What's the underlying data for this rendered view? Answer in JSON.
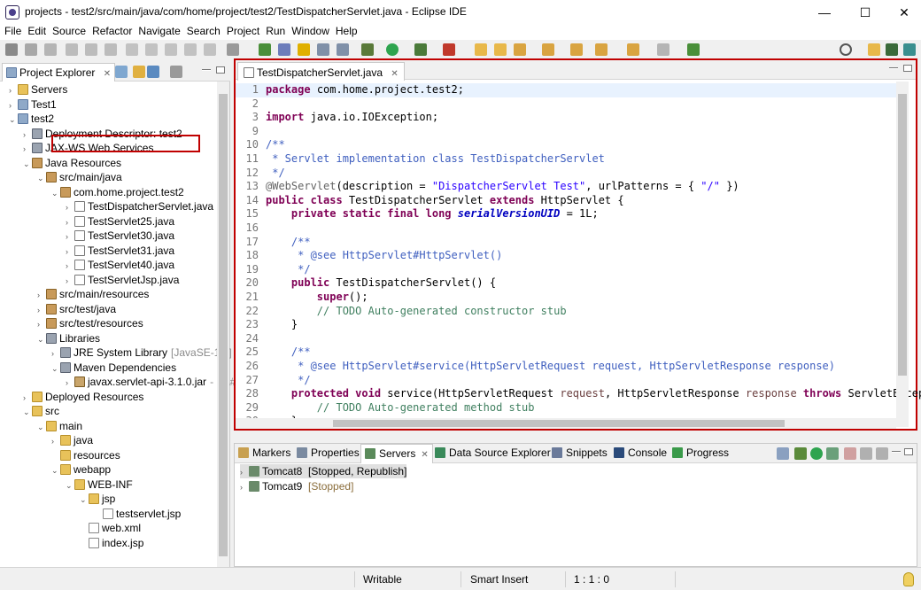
{
  "window": {
    "title": "projects - test2/src/main/java/com/home/project/test2/TestDispatcherServlet.java - Eclipse IDE",
    "min_glyph": "—",
    "max_glyph": "☐",
    "close_glyph": "✕"
  },
  "menu": [
    "File",
    "Edit",
    "Source",
    "Refactor",
    "Navigate",
    "Search",
    "Project",
    "Run",
    "Window",
    "Help"
  ],
  "project_explorer": {
    "tab_label": "Project Explorer",
    "close_glyph": "✕",
    "tree": [
      {
        "label": "Servers",
        "icon": "folder-icon",
        "arrow": "›"
      },
      {
        "label": "Test1",
        "icon": "project-icon",
        "arrow": "›"
      },
      {
        "label": "test2",
        "icon": "project-icon",
        "arrow": "⌄"
      },
      {
        "label": "Deployment Descriptor: test2",
        "icon": "descriptor-icon",
        "arrow": "›"
      },
      {
        "label": "JAX-WS Web Services",
        "icon": "webservice-icon",
        "arrow": "›"
      },
      {
        "label": "Java Resources",
        "icon": "java-resources-icon",
        "arrow": "⌄"
      },
      {
        "label": "src/main/java",
        "icon": "source-folder-icon",
        "arrow": "⌄"
      },
      {
        "label": "com.home.project.test2",
        "icon": "package-icon",
        "arrow": "⌄"
      },
      {
        "label": "TestDispatcherServlet.java",
        "icon": "java-file-icon",
        "arrow": "›"
      },
      {
        "label": "TestServlet25.java",
        "icon": "java-file-icon",
        "arrow": "›"
      },
      {
        "label": "TestServlet30.java",
        "icon": "java-file-icon",
        "arrow": "›"
      },
      {
        "label": "TestServlet31.java",
        "icon": "java-file-icon",
        "arrow": "›"
      },
      {
        "label": "TestServlet40.java",
        "icon": "java-file-icon",
        "arrow": "›"
      },
      {
        "label": "TestServletJsp.java",
        "icon": "java-file-icon",
        "arrow": "›"
      },
      {
        "label": "src/main/resources",
        "icon": "source-folder-icon",
        "arrow": "›"
      },
      {
        "label": "src/test/java",
        "icon": "source-folder-icon",
        "arrow": "›"
      },
      {
        "label": "src/test/resources",
        "icon": "source-folder-icon",
        "arrow": "›"
      },
      {
        "label": "Libraries",
        "icon": "library-icon",
        "arrow": "⌄"
      },
      {
        "label": "JRE System Library",
        "icon": "library-icon",
        "arrow": "›",
        "extra": "[JavaSE-1.8]"
      },
      {
        "label": "Maven Dependencies",
        "icon": "library-icon",
        "arrow": "⌄"
      },
      {
        "label": "javax.servlet-api-3.1.0.jar",
        "icon": "jar-icon",
        "arrow": "›",
        "extra": "- C:\\#"
      },
      {
        "label": "Deployed Resources",
        "icon": "folder-icon",
        "arrow": "›"
      },
      {
        "label": "src",
        "icon": "folder-icon",
        "arrow": "⌄"
      },
      {
        "label": "main",
        "icon": "folder-icon",
        "arrow": "⌄"
      },
      {
        "label": "java",
        "icon": "folder-icon",
        "arrow": "›"
      },
      {
        "label": "resources",
        "icon": "folder-icon",
        "arrow": ""
      },
      {
        "label": "webapp",
        "icon": "folder-icon",
        "arrow": "⌄"
      },
      {
        "label": "WEB-INF",
        "icon": "folder-icon",
        "arrow": "⌄"
      },
      {
        "label": "jsp",
        "icon": "folder-icon",
        "arrow": "⌄"
      },
      {
        "label": "testservlet.jsp",
        "icon": "jsp-file-icon",
        "arrow": ""
      },
      {
        "label": "web.xml",
        "icon": "xml-file-icon",
        "arrow": ""
      },
      {
        "label": "index.jsp",
        "icon": "jsp-file-icon",
        "arrow": ""
      }
    ]
  },
  "editor": {
    "tab_label": "TestDispatcherServlet.java",
    "close_glyph": "✕",
    "lines": [
      {
        "n": "1",
        "segs": [
          [
            "kw",
            "package"
          ],
          [
            "",
            "com.home.project.test2;"
          ]
        ]
      },
      {
        "n": "2",
        "segs": []
      },
      {
        "n": "3",
        "segs": [
          [
            "kw",
            "import"
          ],
          [
            "",
            "java.io.IOException;"
          ]
        ]
      },
      {
        "n": "9",
        "segs": []
      },
      {
        "n": "10",
        "segs": [
          [
            "cm",
            "/**"
          ]
        ]
      },
      {
        "n": "11",
        "segs": [
          [
            "cm",
            " * Servlet implementation class TestDispatcherServlet"
          ]
        ]
      },
      {
        "n": "12",
        "segs": [
          [
            "cm",
            " */"
          ]
        ]
      },
      {
        "n": "13",
        "segs": [
          [
            "ann",
            "@WebServlet"
          ],
          [
            "",
            "(description = "
          ],
          [
            "str",
            "\"DispatcherServlet Test\""
          ],
          [
            "",
            ", urlPatterns = { "
          ],
          [
            "str",
            "\"/\""
          ],
          [
            "",
            " })"
          ]
        ]
      },
      {
        "n": "14",
        "segs": [
          [
            "kw",
            "public class"
          ],
          [
            "",
            " TestDispatcherServlet "
          ],
          [
            "kw",
            "extends"
          ],
          [
            "",
            " HttpServlet {"
          ]
        ]
      },
      {
        "n": "15",
        "segs": [
          [
            "",
            "    "
          ],
          [
            "kw",
            "private static final long"
          ],
          [
            "",
            " "
          ],
          [
            "it",
            "serialVersionUID"
          ],
          [
            "",
            " = 1L;"
          ]
        ]
      },
      {
        "n": "16",
        "segs": []
      },
      {
        "n": "17",
        "segs": [
          [
            "cm",
            "    /**"
          ]
        ]
      },
      {
        "n": "18",
        "segs": [
          [
            "cm",
            "     * @see HttpServlet#HttpServlet()"
          ]
        ]
      },
      {
        "n": "19",
        "segs": [
          [
            "cm",
            "     */"
          ]
        ]
      },
      {
        "n": "20",
        "segs": [
          [
            "",
            "    "
          ],
          [
            "kw",
            "public"
          ],
          [
            "",
            " TestDispatcherServlet() {"
          ]
        ]
      },
      {
        "n": "21",
        "segs": [
          [
            "",
            "        "
          ],
          [
            "kw",
            "super"
          ],
          [
            "",
            "();"
          ]
        ]
      },
      {
        "n": "22",
        "segs": [
          [
            "cm2",
            "        // TODO Auto-generated constructor stub"
          ]
        ]
      },
      {
        "n": "23",
        "segs": [
          [
            "",
            "    }"
          ]
        ]
      },
      {
        "n": "24",
        "segs": []
      },
      {
        "n": "25",
        "segs": [
          [
            "cm",
            "    /**"
          ]
        ]
      },
      {
        "n": "26",
        "segs": [
          [
            "cm",
            "     * @see HttpServlet#service(HttpServletRequest request, HttpServletResponse response)"
          ]
        ]
      },
      {
        "n": "27",
        "segs": [
          [
            "cm",
            "     */"
          ]
        ]
      },
      {
        "n": "28",
        "segs": [
          [
            "",
            "    "
          ],
          [
            "kw",
            "protected void"
          ],
          [
            "",
            " service(HttpServletRequest "
          ],
          [
            "param",
            "request"
          ],
          [
            "",
            ", HttpServletResponse "
          ],
          [
            "param",
            "response"
          ],
          [
            "",
            " "
          ],
          [
            "kw",
            "throws"
          ],
          [
            "",
            " ServletExcep"
          ]
        ]
      },
      {
        "n": "29",
        "segs": [
          [
            "cm2",
            "        // TODO Auto-generated method stub"
          ]
        ]
      },
      {
        "n": "30",
        "segs": [
          [
            "",
            "    }"
          ]
        ]
      }
    ]
  },
  "bottom_panel": {
    "tabs": [
      {
        "label": "Markers",
        "icon": "markers-icon"
      },
      {
        "label": "Properties",
        "icon": "properties-icon"
      },
      {
        "label": "Servers",
        "icon": "servers-icon",
        "active": true
      },
      {
        "label": "Data Source Explorer",
        "icon": "datasource-icon"
      },
      {
        "label": "Snippets",
        "icon": "snippets-icon"
      },
      {
        "label": "Console",
        "icon": "console-icon"
      },
      {
        "label": "Progress",
        "icon": "progress-icon"
      }
    ],
    "close_glyph": "✕",
    "servers": [
      {
        "name": "Tomcat8",
        "state": "[Stopped, Republish]"
      },
      {
        "name": "Tomcat9",
        "state": "[Stopped]"
      }
    ]
  },
  "status_bar": {
    "writable": "Writable",
    "insert_mode": "Smart Insert",
    "position": "1 : 1 : 0"
  },
  "colors": {
    "highlight_border": "#c00000",
    "keyword": "#7f0055",
    "string": "#2a00ff",
    "javadoc": "#3f5fbf",
    "comment": "#3f7f5f"
  }
}
